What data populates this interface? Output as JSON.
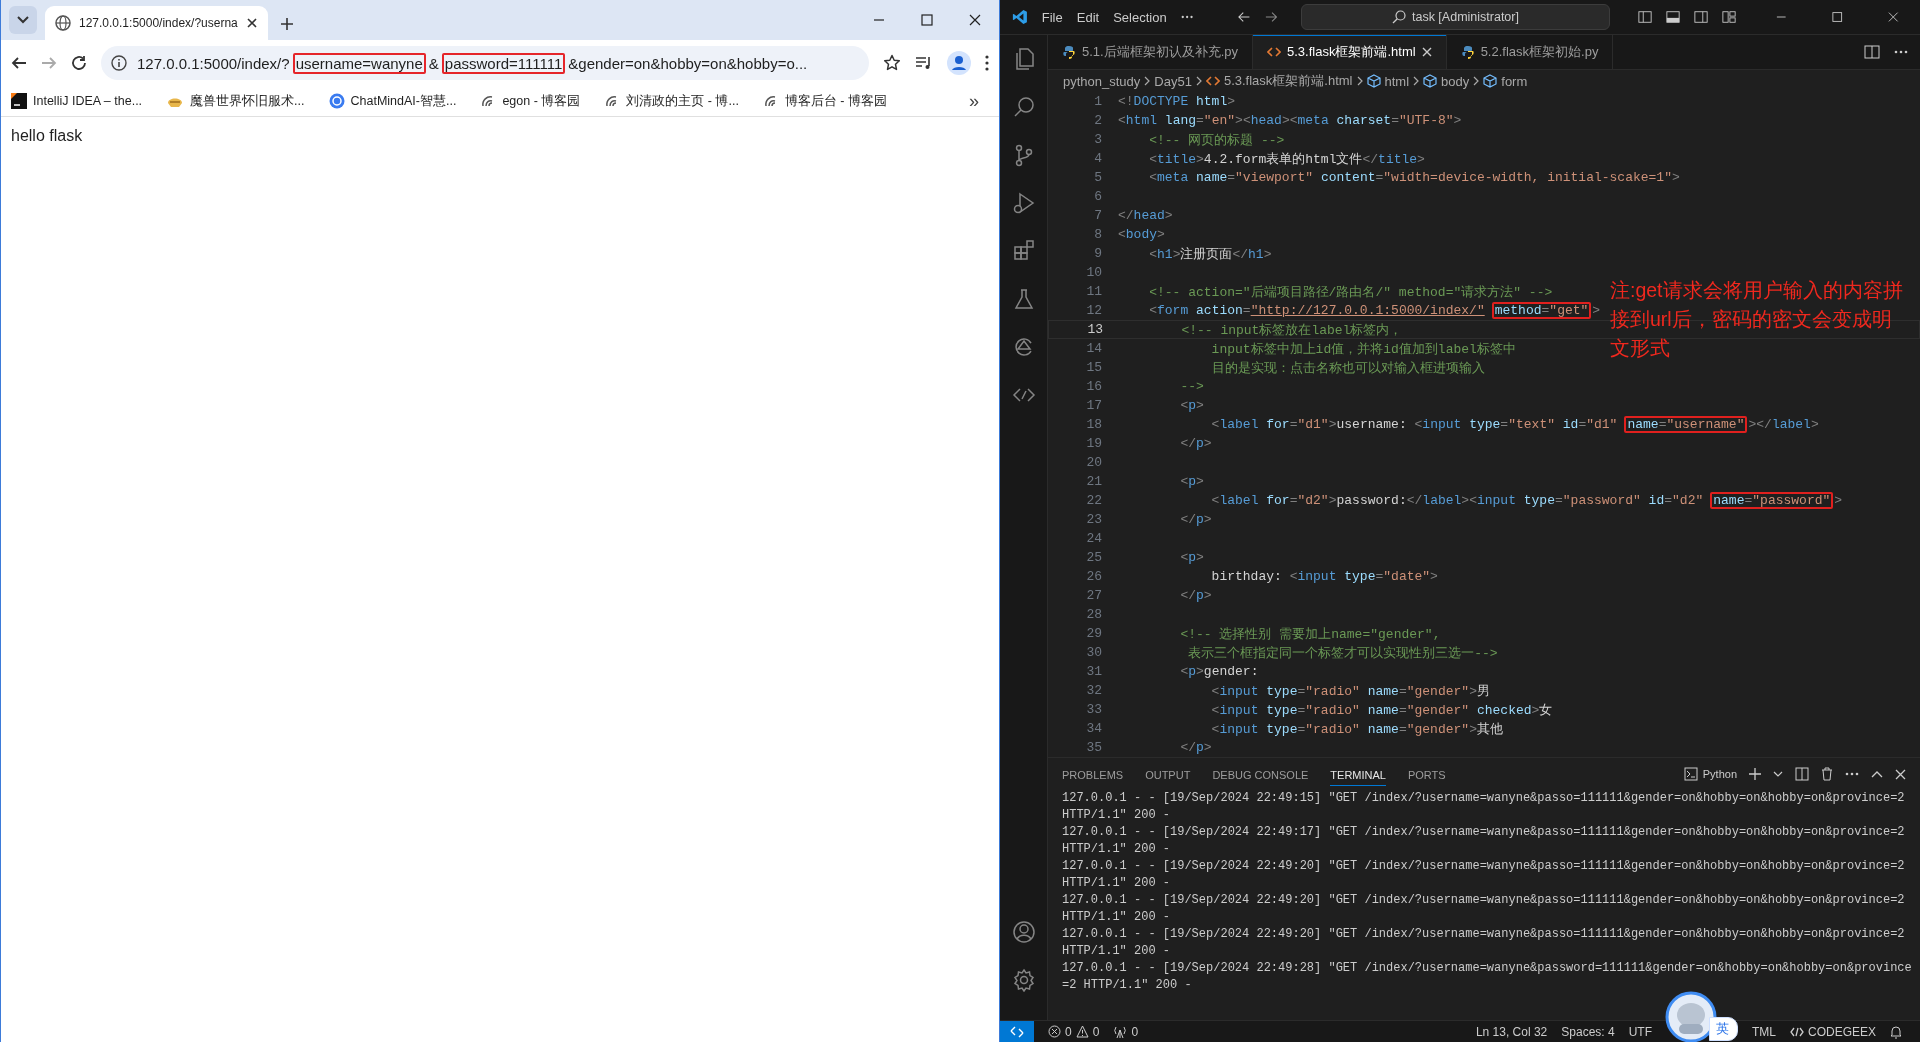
{
  "browser": {
    "tab": {
      "title": "127.0.0.1:5000/index/?userna"
    },
    "address": {
      "segments": [
        {
          "text": "127.0.0.1:5000/index/?",
          "boxed": false
        },
        {
          "text": "username=wanyne",
          "boxed": true
        },
        {
          "text": "&",
          "boxed": false
        },
        {
          "text": "password=111111",
          "boxed": true
        },
        {
          "text": "&gender=on&hobby=on&hobby=o...",
          "boxed": false
        }
      ]
    },
    "bookmarks": [
      {
        "label": "IntelliJ IDEA – the...",
        "kind": "ide"
      },
      {
        "label": "魔兽世界怀旧服术...",
        "kind": "game"
      },
      {
        "label": "ChatMindAI-智慧...",
        "kind": "ai"
      },
      {
        "label": "egon - 博客园",
        "kind": "blog"
      },
      {
        "label": "刘清政的主页 - 博...",
        "kind": "blog"
      },
      {
        "label": "博客后台 - 博客园",
        "kind": "blog"
      }
    ],
    "more_bookmarks": "»",
    "page": {
      "text": "hello flask"
    }
  },
  "vscode": {
    "menu": [
      "File",
      "Edit",
      "Selection"
    ],
    "command_center": "task [Administrator]",
    "tabs": [
      {
        "label": "5.1.后端框架初认及补充.py",
        "kind": "python",
        "selected": false
      },
      {
        "label": "5.3.flask框架前端.html",
        "kind": "html",
        "selected": true
      },
      {
        "label": "5.2.flask框架初始.py",
        "kind": "python",
        "selected": false
      }
    ],
    "breadcrumbs": [
      {
        "label": "python_study",
        "kind": "folder"
      },
      {
        "label": "Day51",
        "kind": "folder"
      },
      {
        "label": "5.3.flask框架前端.html",
        "kind": "html"
      },
      {
        "label": "html",
        "kind": "element"
      },
      {
        "label": "body",
        "kind": "element"
      },
      {
        "label": "form",
        "kind": "element"
      }
    ],
    "lines": [
      {
        "number": "1",
        "active": false,
        "tokens": [
          {
            "kind": "punct",
            "text": "<!"
          },
          {
            "kind": "tag",
            "text": "DOCTYPE"
          },
          {
            "kind": "attr",
            "text": " html"
          },
          {
            "kind": "punct",
            "text": ">"
          }
        ]
      },
      {
        "number": "2",
        "active": false,
        "tokens": [
          {
            "kind": "punct",
            "text": "<"
          },
          {
            "kind": "tag",
            "text": "html"
          },
          {
            "kind": "attr",
            "text": " lang"
          },
          {
            "kind": "punct",
            "text": "="
          },
          {
            "kind": "string",
            "text": "\"en\""
          },
          {
            "kind": "punct",
            "text": "><"
          },
          {
            "kind": "tag",
            "text": "head"
          },
          {
            "kind": "punct",
            "text": "><"
          },
          {
            "kind": "tag",
            "text": "meta"
          },
          {
            "kind": "attr",
            "text": " charset"
          },
          {
            "kind": "punct",
            "text": "="
          },
          {
            "kind": "string",
            "text": "\"UTF-8\""
          },
          {
            "kind": "punct",
            "text": ">"
          }
        ]
      },
      {
        "number": "3",
        "active": false,
        "tokens": [
          {
            "kind": "comment",
            "text": "    <!-- 网页的标题 -->"
          }
        ]
      },
      {
        "number": "4",
        "active": false,
        "tokens": [
          {
            "kind": "punct",
            "text": "    <"
          },
          {
            "kind": "tag",
            "text": "title"
          },
          {
            "kind": "punct",
            "text": ">"
          },
          {
            "kind": "text",
            "text": "4.2.form表单的html文件"
          },
          {
            "kind": "punct",
            "text": "</"
          },
          {
            "kind": "tag",
            "text": "title"
          },
          {
            "kind": "punct",
            "text": ">"
          }
        ]
      },
      {
        "number": "5",
        "active": false,
        "tokens": [
          {
            "kind": "punct",
            "text": "    <"
          },
          {
            "kind": "tag",
            "text": "meta"
          },
          {
            "kind": "attr",
            "text": " name"
          },
          {
            "kind": "punct",
            "text": "="
          },
          {
            "kind": "string",
            "text": "\"viewport\""
          },
          {
            "kind": "attr",
            "text": " content"
          },
          {
            "kind": "punct",
            "text": "="
          },
          {
            "kind": "string",
            "text": "\"width=device-width, initial-scake=1\""
          },
          {
            "kind": "punct",
            "text": ">"
          }
        ]
      },
      {
        "number": "6",
        "active": false
      },
      {
        "number": "7",
        "active": false,
        "tokens": [
          {
            "kind": "punct",
            "text": "</"
          },
          {
            "kind": "tag",
            "text": "head"
          },
          {
            "kind": "punct",
            "text": ">"
          }
        ]
      },
      {
        "number": "8",
        "active": false,
        "tokens": [
          {
            "kind": "punct",
            "text": "<"
          },
          {
            "kind": "tag",
            "text": "body"
          },
          {
            "kind": "punct",
            "text": ">"
          }
        ]
      },
      {
        "number": "9",
        "active": false,
        "tokens": [
          {
            "kind": "punct",
            "text": "    <"
          },
          {
            "kind": "tag",
            "text": "h1"
          },
          {
            "kind": "punct",
            "text": ">"
          },
          {
            "kind": "text",
            "text": "注册页面"
          },
          {
            "kind": "punct",
            "text": "</"
          },
          {
            "kind": "tag",
            "text": "h1"
          },
          {
            "kind": "punct",
            "text": ">"
          }
        ]
      },
      {
        "number": "10",
        "active": false
      },
      {
        "number": "11",
        "active": false,
        "tokens": [
          {
            "kind": "comment",
            "text": "    <!-- action=\"后端项目路径/路由名/\" method=\"请求方法\" -->"
          }
        ]
      },
      {
        "number": "12",
        "active": false,
        "tokens": [
          {
            "kind": "punct",
            "text": "    <"
          },
          {
            "kind": "tag",
            "text": "form"
          },
          {
            "kind": "attr",
            "text": " action"
          },
          {
            "kind": "punct",
            "text": "="
          },
          {
            "kind": "link",
            "text": "\"http://127.0.0.1:5000/index/\""
          },
          {
            "kind": "box",
            "tokens": [
              {
                "kind": "attr",
                "text": "method"
              },
              {
                "kind": "punct",
                "text": "="
              },
              {
                "kind": "string",
                "text": "\"get\""
              }
            ]
          },
          {
            "kind": "punct",
            "text": ">"
          }
        ]
      },
      {
        "number": "13",
        "active": true,
        "tokens": [
          {
            "kind": "comment",
            "text": "        <!-- input标签放在label标签内，"
          }
        ]
      },
      {
        "number": "14",
        "active": false,
        "tokens": [
          {
            "kind": "comment",
            "text": "            input标签中加上id值，并将id值加到label标签中"
          }
        ]
      },
      {
        "number": "15",
        "active": false,
        "tokens": [
          {
            "kind": "comment",
            "text": "            目的是实现：点击名称也可以对输入框进项输入"
          }
        ]
      },
      {
        "number": "16",
        "active": false,
        "tokens": [
          {
            "kind": "comment",
            "text": "        -->"
          }
        ]
      },
      {
        "number": "17",
        "active": false,
        "tokens": [
          {
            "kind": "punct",
            "text": "        <"
          },
          {
            "kind": "tag",
            "text": "p"
          },
          {
            "kind": "punct",
            "text": ">"
          }
        ]
      },
      {
        "number": "18",
        "active": false,
        "tokens": [
          {
            "kind": "punct",
            "text": "            <"
          },
          {
            "kind": "tag",
            "text": "label"
          },
          {
            "kind": "attr",
            "text": " for"
          },
          {
            "kind": "punct",
            "text": "="
          },
          {
            "kind": "string",
            "text": "\"d1\""
          },
          {
            "kind": "punct",
            "text": ">"
          },
          {
            "kind": "text",
            "text": "username: "
          },
          {
            "kind": "punct",
            "text": "<"
          },
          {
            "kind": "tag",
            "text": "input"
          },
          {
            "kind": "attr",
            "text": " type"
          },
          {
            "kind": "punct",
            "text": "="
          },
          {
            "kind": "string",
            "text": "\"text\""
          },
          {
            "kind": "attr",
            "text": " id"
          },
          {
            "kind": "punct",
            "text": "="
          },
          {
            "kind": "string",
            "text": "\"d1\""
          },
          {
            "kind": "box",
            "tokens": [
              {
                "kind": "attr",
                "text": "name"
              },
              {
                "kind": "punct",
                "text": "="
              },
              {
                "kind": "string",
                "text": "\"username\""
              }
            ]
          },
          {
            "kind": "punct",
            "text": "></"
          },
          {
            "kind": "tag",
            "text": "label"
          },
          {
            "kind": "punct",
            "text": ">"
          }
        ]
      },
      {
        "number": "19",
        "active": false,
        "tokens": [
          {
            "kind": "punct",
            "text": "        </"
          },
          {
            "kind": "tag",
            "text": "p"
          },
          {
            "kind": "punct",
            "text": ">"
          }
        ]
      },
      {
        "number": "20",
        "active": false
      },
      {
        "number": "21",
        "active": false,
        "tokens": [
          {
            "kind": "punct",
            "text": "        <"
          },
          {
            "kind": "tag",
            "text": "p"
          },
          {
            "kind": "punct",
            "text": ">"
          }
        ]
      },
      {
        "number": "22",
        "active": false,
        "tokens": [
          {
            "kind": "punct",
            "text": "            <"
          },
          {
            "kind": "tag",
            "text": "label"
          },
          {
            "kind": "attr",
            "text": " for"
          },
          {
            "kind": "punct",
            "text": "="
          },
          {
            "kind": "string",
            "text": "\"d2\""
          },
          {
            "kind": "punct",
            "text": ">"
          },
          {
            "kind": "text",
            "text": "password:"
          },
          {
            "kind": "punct",
            "text": "</"
          },
          {
            "kind": "tag",
            "text": "label"
          },
          {
            "kind": "punct",
            "text": "><"
          },
          {
            "kind": "tag",
            "text": "input"
          },
          {
            "kind": "attr",
            "text": " type"
          },
          {
            "kind": "punct",
            "text": "="
          },
          {
            "kind": "string",
            "text": "\"password\""
          },
          {
            "kind": "attr",
            "text": " id"
          },
          {
            "kind": "punct",
            "text": "="
          },
          {
            "kind": "string",
            "text": "\"d2\""
          },
          {
            "kind": "box",
            "tokens": [
              {
                "kind": "attr",
                "text": "name"
              },
              {
                "kind": "punct",
                "text": "="
              },
              {
                "kind": "string",
                "text": "\"password\""
              }
            ]
          },
          {
            "kind": "punct",
            "text": ">"
          }
        ]
      },
      {
        "number": "23",
        "active": false,
        "tokens": [
          {
            "kind": "punct",
            "text": "        </"
          },
          {
            "kind": "tag",
            "text": "p"
          },
          {
            "kind": "punct",
            "text": ">"
          }
        ]
      },
      {
        "number": "24",
        "active": false
      },
      {
        "number": "25",
        "active": false,
        "tokens": [
          {
            "kind": "punct",
            "text": "        <"
          },
          {
            "kind": "tag",
            "text": "p"
          },
          {
            "kind": "punct",
            "text": ">"
          }
        ]
      },
      {
        "number": "26",
        "active": false,
        "tokens": [
          {
            "kind": "text",
            "text": "            birthday: "
          },
          {
            "kind": "punct",
            "text": "<"
          },
          {
            "kind": "tag",
            "text": "input"
          },
          {
            "kind": "attr",
            "text": " type"
          },
          {
            "kind": "punct",
            "text": "="
          },
          {
            "kind": "string",
            "text": "\"date\""
          },
          {
            "kind": "punct",
            "text": ">"
          }
        ]
      },
      {
        "number": "27",
        "active": false,
        "tokens": [
          {
            "kind": "punct",
            "text": "        </"
          },
          {
            "kind": "tag",
            "text": "p"
          },
          {
            "kind": "punct",
            "text": ">"
          }
        ]
      },
      {
        "number": "28",
        "active": false
      },
      {
        "number": "29",
        "active": false,
        "tokens": [
          {
            "kind": "comment",
            "text": "        <!-- 选择性别 需要加上name=\"gender\","
          }
        ]
      },
      {
        "number": "30",
        "active": false,
        "tokens": [
          {
            "kind": "comment",
            "text": "         表示三个框指定同一个标签才可以实现性别三选一-->"
          }
        ]
      },
      {
        "number": "31",
        "active": false,
        "tokens": [
          {
            "kind": "punct",
            "text": "        <"
          },
          {
            "kind": "tag",
            "text": "p"
          },
          {
            "kind": "punct",
            "text": ">"
          },
          {
            "kind": "text",
            "text": "gender:"
          }
        ]
      },
      {
        "number": "32",
        "active": false,
        "tokens": [
          {
            "kind": "punct",
            "text": "            <"
          },
          {
            "kind": "tag",
            "text": "input"
          },
          {
            "kind": "attr",
            "text": " type"
          },
          {
            "kind": "punct",
            "text": "="
          },
          {
            "kind": "string",
            "text": "\"radio\""
          },
          {
            "kind": "attr",
            "text": " name"
          },
          {
            "kind": "punct",
            "text": "="
          },
          {
            "kind": "string",
            "text": "\"gender\""
          },
          {
            "kind": "punct",
            "text": ">"
          },
          {
            "kind": "text",
            "text": "男"
          }
        ]
      },
      {
        "number": "33",
        "active": false,
        "tokens": [
          {
            "kind": "punct",
            "text": "            <"
          },
          {
            "kind": "tag",
            "text": "input"
          },
          {
            "kind": "attr",
            "text": " type"
          },
          {
            "kind": "punct",
            "text": "="
          },
          {
            "kind": "string",
            "text": "\"radio\""
          },
          {
            "kind": "attr",
            "text": " name"
          },
          {
            "kind": "punct",
            "text": "="
          },
          {
            "kind": "string",
            "text": "\"gender\""
          },
          {
            "kind": "attr",
            "text": " checked"
          },
          {
            "kind": "punct",
            "text": ">"
          },
          {
            "kind": "text",
            "text": "女"
          }
        ]
      },
      {
        "number": "34",
        "active": false,
        "tokens": [
          {
            "kind": "punct",
            "text": "            <"
          },
          {
            "kind": "tag",
            "text": "input"
          },
          {
            "kind": "attr",
            "text": " type"
          },
          {
            "kind": "punct",
            "text": "="
          },
          {
            "kind": "string",
            "text": "\"radio\""
          },
          {
            "kind": "attr",
            "text": " name"
          },
          {
            "kind": "punct",
            "text": "="
          },
          {
            "kind": "string",
            "text": "\"gender\""
          },
          {
            "kind": "punct",
            "text": ">"
          },
          {
            "kind": "text",
            "text": "其他"
          }
        ]
      },
      {
        "number": "35",
        "active": false,
        "tokens": [
          {
            "kind": "punct",
            "text": "        </"
          },
          {
            "kind": "tag",
            "text": "p"
          },
          {
            "kind": "punct",
            "text": ">"
          }
        ]
      }
    ],
    "annotation": "注:get请求会将用户输入的内容拼接到url后，密码的密文会变成明文形式",
    "panel": {
      "tabs": [
        {
          "label": "PROBLEMS",
          "selected": false
        },
        {
          "label": "OUTPUT",
          "selected": false
        },
        {
          "label": "DEBUG CONSOLE",
          "selected": false
        },
        {
          "label": "TERMINAL",
          "selected": true
        },
        {
          "label": "PORTS",
          "selected": false
        }
      ],
      "shell": "Python",
      "terminal_lines": [
        "127.0.0.1 - - [19/Sep/2024 22:49:15] \"GET /index/?username=wanyne&passo=111111&gender=on&hobby=on&hobby=on&province=2",
        "HTTP/1.1\" 200 -",
        "127.0.0.1 - - [19/Sep/2024 22:49:17] \"GET /index/?username=wanyne&passo=111111&gender=on&hobby=on&hobby=on&province=2",
        "HTTP/1.1\" 200 -",
        "127.0.0.1 - - [19/Sep/2024 22:49:20] \"GET /index/?username=wanyne&passo=111111&gender=on&hobby=on&hobby=on&province=2",
        "HTTP/1.1\" 200 -",
        "127.0.0.1 - - [19/Sep/2024 22:49:20] \"GET /index/?username=wanyne&passo=111111&gender=on&hobby=on&hobby=on&province=2",
        "HTTP/1.1\" 200 -",
        "127.0.0.1 - - [19/Sep/2024 22:49:20] \"GET /index/?username=wanyne&passo=111111&gender=on&hobby=on&hobby=on&province=2",
        "HTTP/1.1\" 200 -",
        "127.0.0.1 - - [19/Sep/2024 22:49:28] \"GET /index/?username=wanyne&password=111111&gender=on&hobby=on&hobby=on&province",
        "=2 HTTP/1.1\" 200 -"
      ]
    },
    "status": {
      "errors": "0",
      "warnings": "0",
      "ports": "0",
      "items": [
        {
          "label": "Ln 13, Col 32",
          "kind": "plain"
        },
        {
          "label": "Spaces: 4",
          "kind": "plain"
        },
        {
          "label": "UTF",
          "kind": "plain"
        },
        {
          "label": "TML",
          "kind": "covered"
        },
        {
          "label": "CODEGEEX",
          "kind": "codegeex"
        }
      ],
      "ime": "英"
    }
  }
}
